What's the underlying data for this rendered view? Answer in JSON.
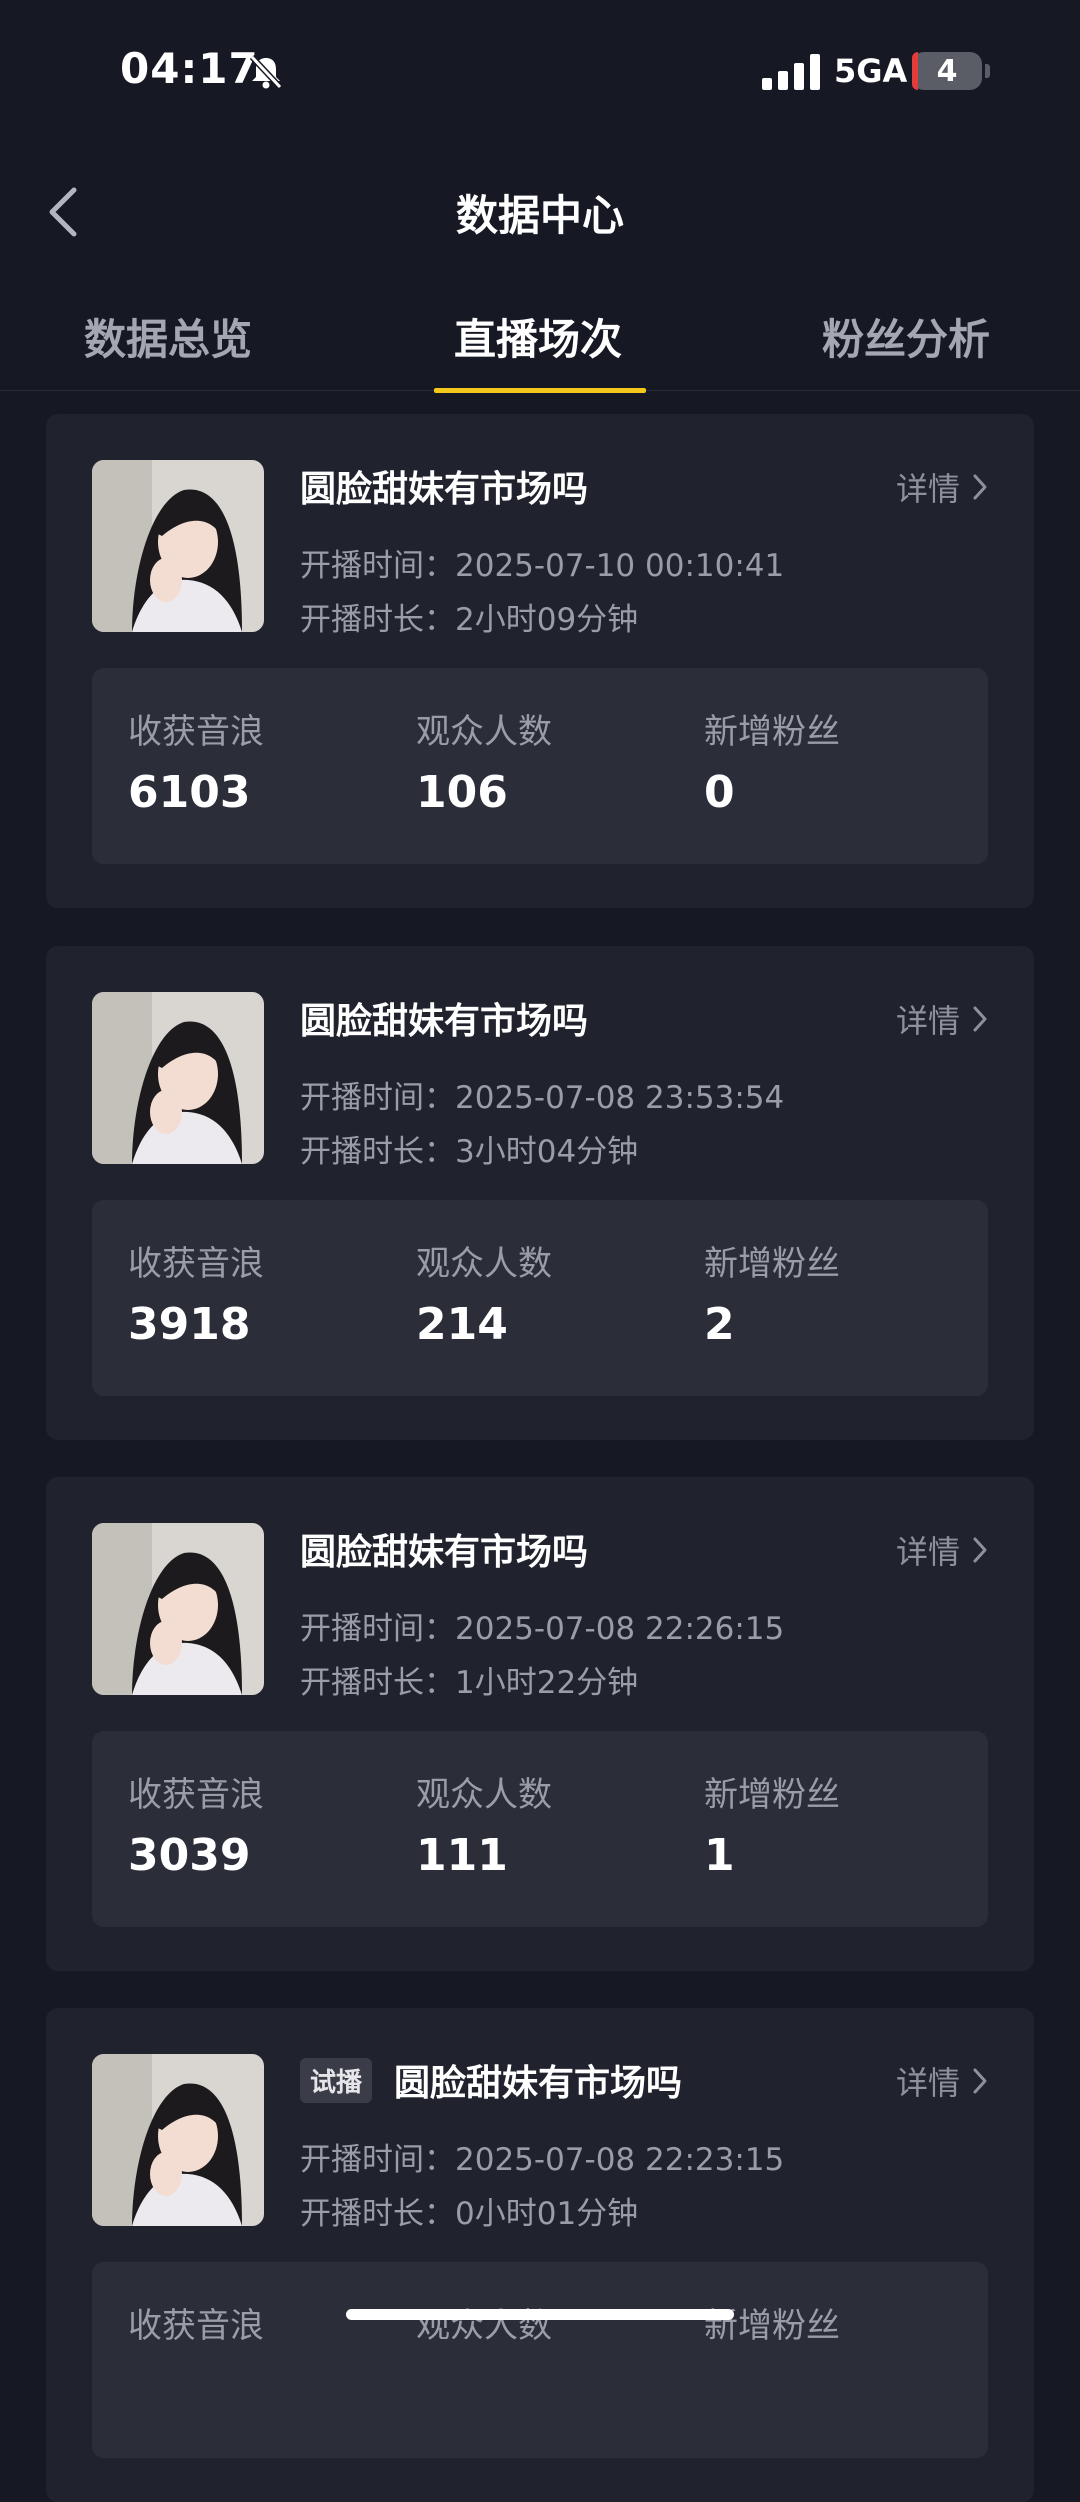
{
  "status_bar": {
    "time": "04:17",
    "network": "5GA",
    "battery": "4"
  },
  "header": {
    "title": "数据中心"
  },
  "tabs": [
    {
      "label": "数据总览",
      "active": false
    },
    {
      "label": "直播场次",
      "active": true
    },
    {
      "label": "粉丝分析",
      "active": false
    }
  ],
  "sessions": [
    {
      "tag": "",
      "name": "圆脸甜妹有市场吗",
      "detail": "详情",
      "start_label": "开播时间：",
      "start_time": "2025-07-10 00:10:41",
      "duration_label": "开播时长：",
      "duration": "2小时09分钟",
      "stats": [
        {
          "label": "收获音浪",
          "value": "6103"
        },
        {
          "label": "观众人数",
          "value": "106"
        },
        {
          "label": "新增粉丝",
          "value": "0"
        }
      ]
    },
    {
      "tag": "",
      "name": "圆脸甜妹有市场吗",
      "detail": "详情",
      "start_label": "开播时间：",
      "start_time": "2025-07-08 23:53:54",
      "duration_label": "开播时长：",
      "duration": "3小时04分钟",
      "stats": [
        {
          "label": "收获音浪",
          "value": "3918"
        },
        {
          "label": "观众人数",
          "value": "214"
        },
        {
          "label": "新增粉丝",
          "value": "2"
        }
      ]
    },
    {
      "tag": "",
      "name": "圆脸甜妹有市场吗",
      "detail": "详情",
      "start_label": "开播时间：",
      "start_time": "2025-07-08 22:26:15",
      "duration_label": "开播时长：",
      "duration": "1小时22分钟",
      "stats": [
        {
          "label": "收获音浪",
          "value": "3039"
        },
        {
          "label": "观众人数",
          "value": "111"
        },
        {
          "label": "新增粉丝",
          "value": "1"
        }
      ]
    },
    {
      "tag": "试播",
      "name": "圆脸甜妹有市场吗",
      "detail": "详情",
      "start_label": "开播时间：",
      "start_time": "2025-07-08 22:23:15",
      "duration_label": "开播时长：",
      "duration": "0小时01分钟",
      "stats": [
        {
          "label": "收获音浪",
          "value": ""
        },
        {
          "label": "观众人数",
          "value": ""
        },
        {
          "label": "新增粉丝",
          "value": ""
        }
      ]
    }
  ]
}
